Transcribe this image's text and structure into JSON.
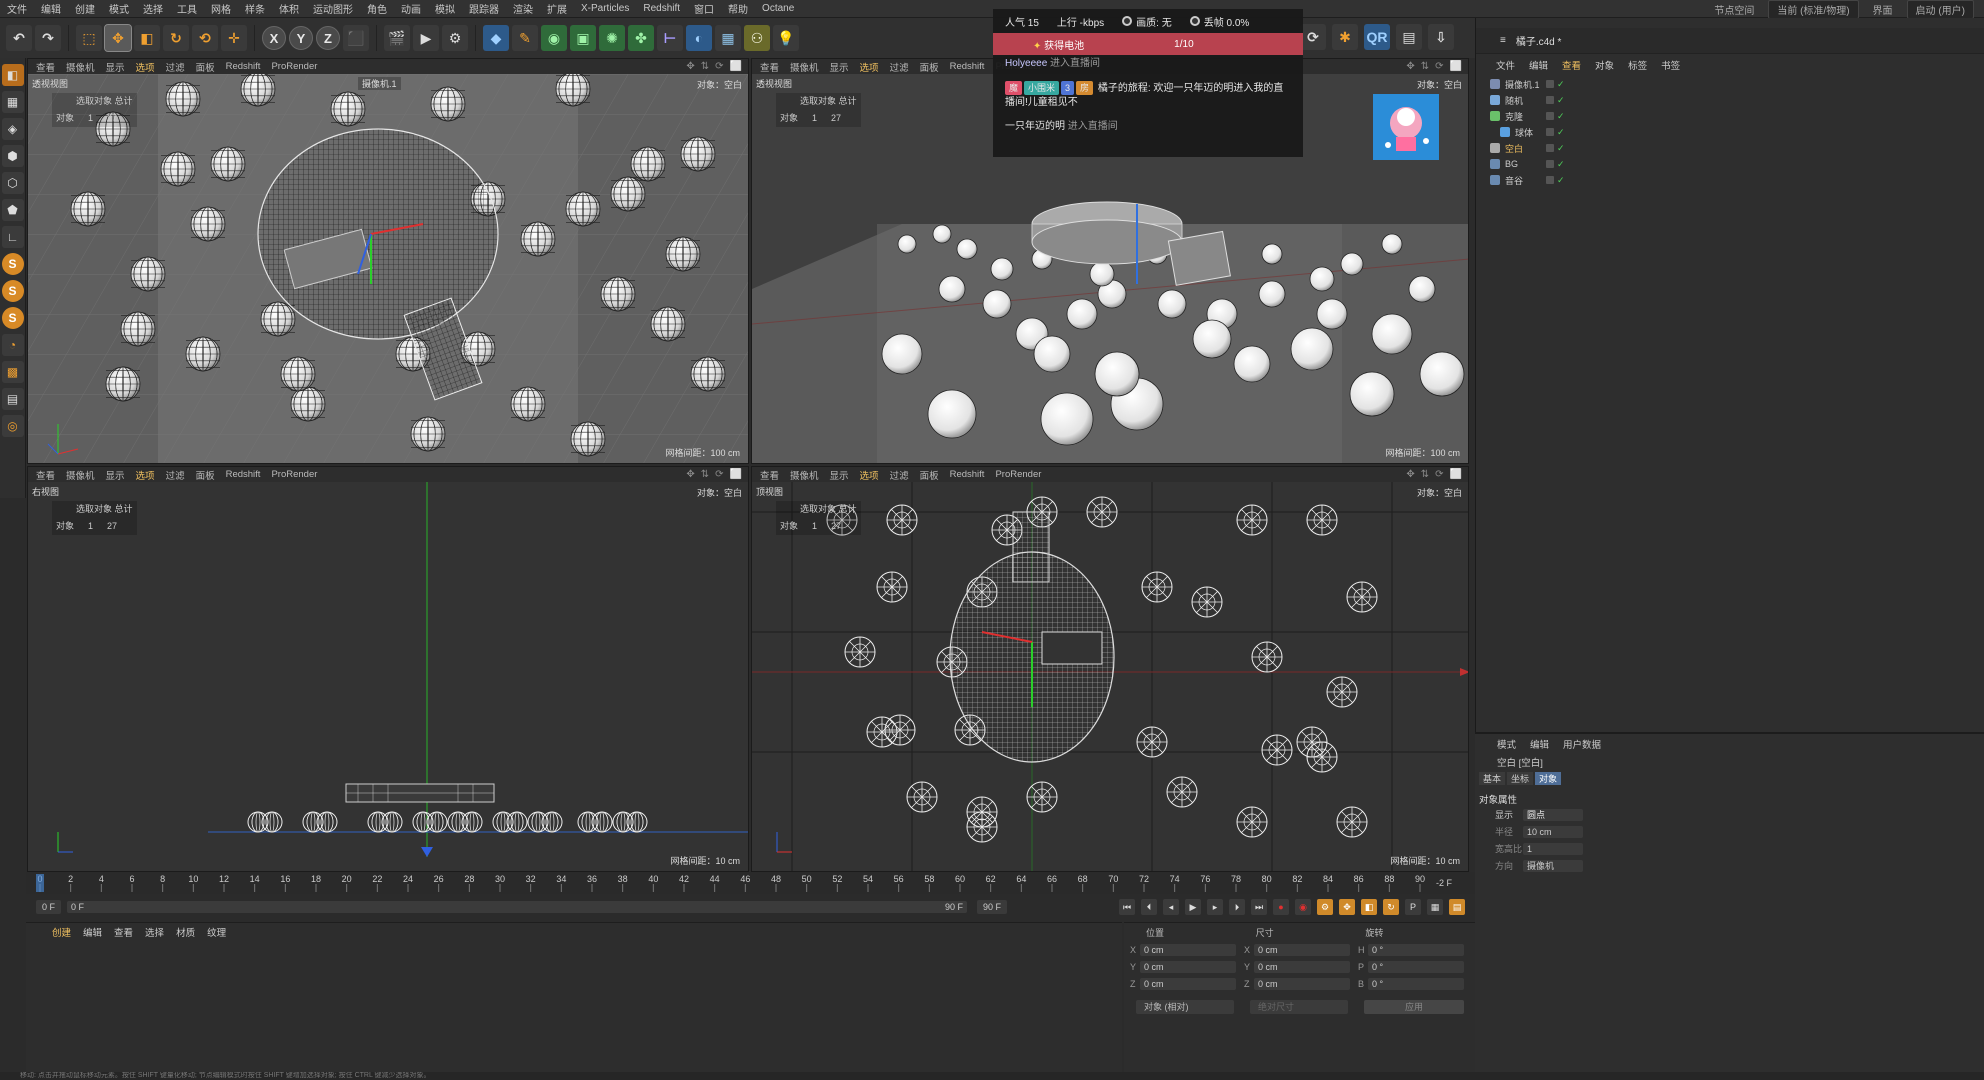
{
  "menu": [
    "文件",
    "编辑",
    "创建",
    "模式",
    "选择",
    "工具",
    "网格",
    "样条",
    "体积",
    "运动图形",
    "角色",
    "动画",
    "模拟",
    "跟踪器",
    "渲染",
    "扩展",
    "X-Particles",
    "Redshift",
    "窗口",
    "帮助",
    "Octane"
  ],
  "menu_right": {
    "node_space": "节点空间",
    "node_value": "当前 (标准/物理)",
    "layout": "界面",
    "layout_value": "启动 (用户)"
  },
  "viewport_menu": [
    "查看",
    "摄像机",
    "显示",
    "选项",
    "过滤",
    "面板",
    "Redshift",
    "ProRender"
  ],
  "viewports": {
    "tl": {
      "name": "透视视图",
      "stats_label": "选取对象 总计",
      "obj_label": "对象",
      "obj_sel": "1",
      "obj_total": "27",
      "right": "对象：空白",
      "camera": "摄像机.1",
      "grid": "网格间距：100 cm"
    },
    "tr": {
      "name": "透视视图",
      "stats_label": "选取对象 总计",
      "obj_label": "对象",
      "obj_sel": "1",
      "obj_total": "27",
      "right": "对象：空白",
      "grid": "网格间距：100 cm"
    },
    "bl": {
      "name": "右视图",
      "stats_label": "选取对象 总计",
      "obj_label": "对象",
      "obj_sel": "1",
      "obj_total": "27",
      "right": "对象：空白",
      "grid": "网格间距：10 cm"
    },
    "br": {
      "name": "顶视图",
      "stats_label": "选取对象 总计",
      "obj_label": "对象",
      "obj_sel": "1",
      "obj_total": "27",
      "right": "对象：空白",
      "grid": "网格间距：10 cm"
    }
  },
  "overlay": {
    "popularity": "人气 15",
    "upload": "上行 -kbps",
    "quality": "画质: 无",
    "drop": "丢帧 0.0%",
    "bar_left": "获得电池",
    "bar_right": "1/10",
    "line1_user": "Holyeeee",
    "line1_msg": "进入直播间",
    "tag1": "魔",
    "tag2": "小围米",
    "tag3": "3",
    "tag4": "房",
    "line2_msg": "橘子的旅程: 欢迎一只年迈的明进入我的直播间!儿童租见不",
    "line3_user": "一只年迈的明",
    "line3_msg": "进入直播间"
  },
  "objmgr": {
    "tabs": [
      "文件",
      "编辑",
      "查看",
      "对象",
      "标签",
      "书签"
    ],
    "doc": "橘子.c4d *",
    "objects": [
      {
        "name": "摄像机.1",
        "indent": 0,
        "color": "#7c8cb0"
      },
      {
        "name": "随机",
        "indent": 0,
        "color": "#7aa8d8"
      },
      {
        "name": "克隆",
        "indent": 0,
        "color": "#6ac06a"
      },
      {
        "name": "球体",
        "indent": 1,
        "color": "#5aa0e0"
      },
      {
        "name": "空白",
        "indent": 0,
        "color": "#aaaaaa",
        "selected": true
      },
      {
        "name": "BG",
        "indent": 0,
        "color": "#6a8ab0"
      },
      {
        "name": "音谷",
        "indent": 0,
        "color": "#6a8ab0"
      }
    ]
  },
  "attr": {
    "menu": [
      "模式",
      "编辑",
      "用户数据"
    ],
    "title": "空白 [空白]",
    "tabs": [
      "基本",
      "坐标",
      "对象"
    ],
    "section": "对象属性",
    "props": [
      {
        "label": "显示",
        "value": "圆点"
      },
      {
        "label": "半径",
        "value": "10 cm"
      },
      {
        "label": "宽高比",
        "value": "1"
      },
      {
        "label": "方向",
        "value": "摄像机"
      }
    ]
  },
  "timeline": {
    "ticks": [
      "0",
      "2",
      "4",
      "6",
      "8",
      "10",
      "12",
      "14",
      "16",
      "18",
      "20",
      "22",
      "24",
      "26",
      "28",
      "30",
      "32",
      "34",
      "36",
      "38",
      "40",
      "42",
      "44",
      "46",
      "48",
      "50",
      "52",
      "54",
      "56",
      "58",
      "60",
      "62",
      "64",
      "66",
      "68",
      "70",
      "72",
      "74",
      "76",
      "78",
      "80",
      "82",
      "84",
      "86",
      "88",
      "90"
    ],
    "current": "0 F",
    "start": "0 F",
    "end": "90 F",
    "end2": "90 F",
    "offset": "-2 F"
  },
  "matmgr": {
    "menu": [
      "创建",
      "编辑",
      "查看",
      "选择",
      "材质",
      "纹理"
    ]
  },
  "coord": {
    "headers": [
      "位置",
      "尺寸",
      "旋转"
    ],
    "rows": [
      {
        "a": "X",
        "p": "0 cm",
        "b": "X",
        "s": "0 cm",
        "c": "H",
        "r": "0 °"
      },
      {
        "a": "Y",
        "p": "0 cm",
        "b": "Y",
        "s": "0 cm",
        "c": "P",
        "r": "0 °"
      },
      {
        "a": "Z",
        "p": "0 cm",
        "b": "Z",
        "s": "0 cm",
        "c": "B",
        "r": "0 °"
      }
    ],
    "mode": "对象 (相对)",
    "size_mode": "绝对尺寸",
    "apply": "应用"
  },
  "status": "移动: 点击并拖动鼠标移动元素。按住 SHIFT 键量化移动; 节点编辑模式时按住 SHIFT 键增加选择对象; 按住 CTRL 键减少选择对象。"
}
